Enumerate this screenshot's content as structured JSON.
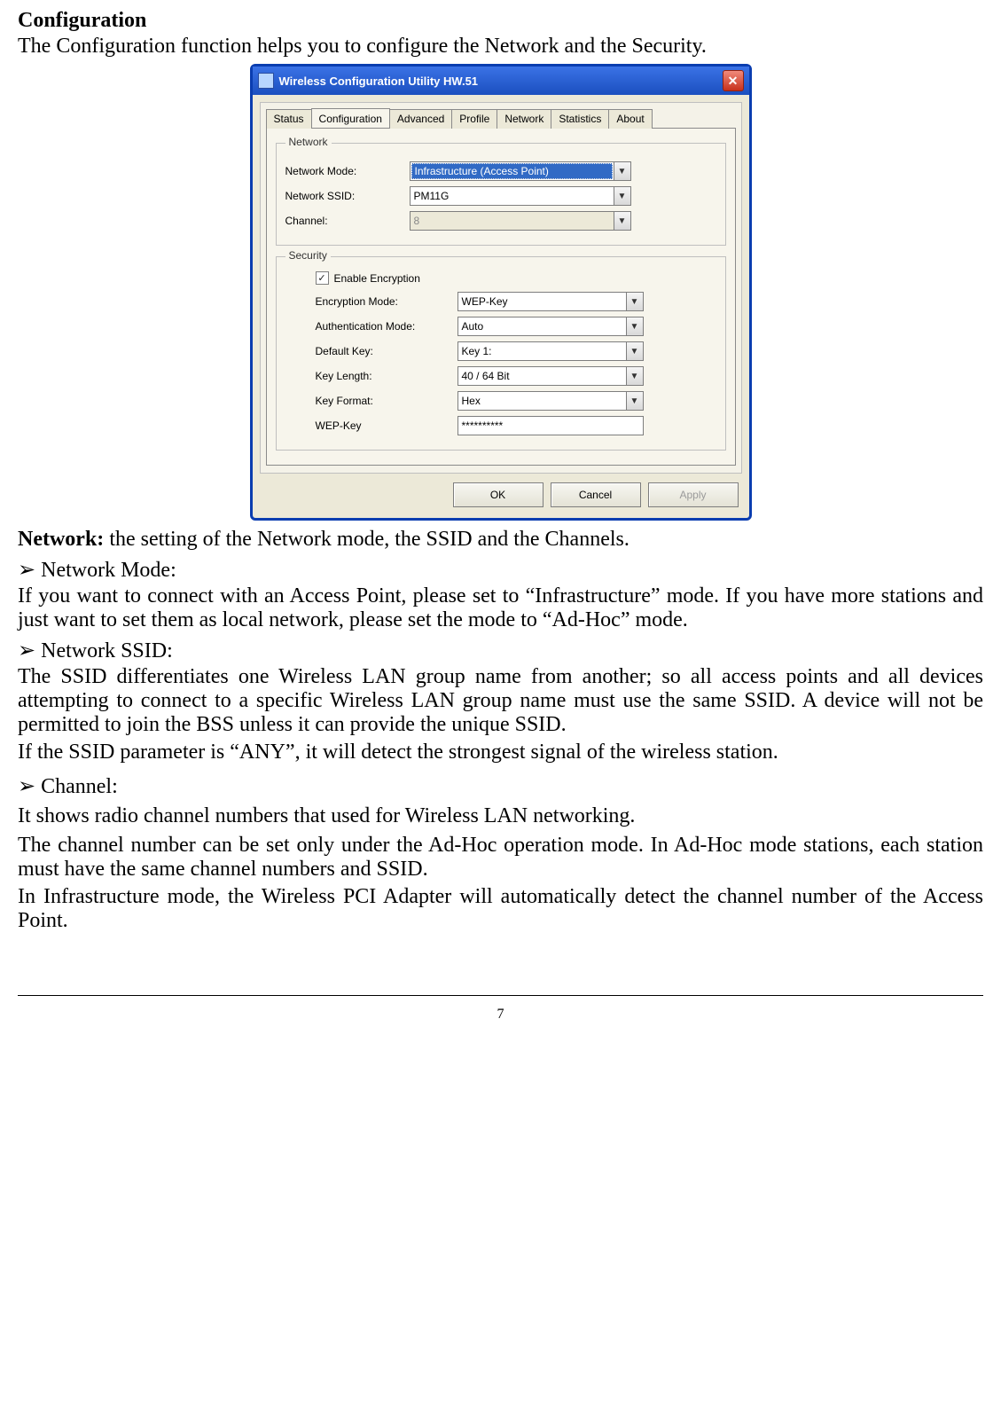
{
  "doc": {
    "title": "Configuration",
    "intro": "The Configuration function helps you to configure the Network and the Security.",
    "network_heading_bold": "Network:",
    "network_heading_rest": " the setting of the Network mode, the SSID and the Channels.",
    "bullets": {
      "mode": "Network Mode:",
      "ssid": "Network SSID:",
      "channel": "Channel:"
    },
    "mode_text": "If you want to connect with an Access Point, please set to “Infrastructure” mode. If you have more stations and just want to set them as local network, please set the mode to “Ad-Hoc” mode.",
    "ssid_text1": "The SSID differentiates one Wireless LAN group name from another; so all access points and all devices attempting to connect to a specific Wireless LAN group name must use the same SSID. A device will not be permitted to join the BSS unless it can provide the unique SSID.",
    "ssid_text2": "If the SSID parameter is “ANY”, it will detect the strongest signal of the wireless station.",
    "channel_text1": "It shows radio channel numbers that used for Wireless LAN networking.",
    "channel_text2": "The channel number can be set only under the Ad-Hoc operation mode. In Ad-Hoc mode stations, each station must have the same channel numbers and SSID.",
    "channel_text3": "In Infrastructure mode, the Wireless PCI Adapter will automatically detect the channel number of the Access Point.",
    "page_number": "7"
  },
  "win": {
    "title": "Wireless Configuration Utility HW.51",
    "tabs": [
      "Status",
      "Configuration",
      "Advanced",
      "Profile",
      "Network",
      "Statistics",
      "About"
    ],
    "active_tab": 1,
    "groups": {
      "network": {
        "title": "Network",
        "mode_label": "Network Mode:",
        "mode_value": "Infrastructure (Access Point)",
        "ssid_label": "Network SSID:",
        "ssid_value": "PM11G",
        "channel_label": "Channel:",
        "channel_value": "8"
      },
      "security": {
        "title": "Security",
        "enable_label": "Enable Encryption",
        "enc_mode_label": "Encryption Mode:",
        "enc_mode_value": "WEP-Key",
        "auth_label": "Authentication Mode:",
        "auth_value": "Auto",
        "defkey_label": "Default Key:",
        "defkey_value": "Key 1:",
        "keylen_label": "Key Length:",
        "keylen_value": "40 / 64 Bit",
        "keyfmt_label": "Key Format:",
        "keyfmt_value": "Hex",
        "wepkey_label": "WEP-Key",
        "wepkey_value": "**********"
      }
    },
    "buttons": {
      "ok": "OK",
      "cancel": "Cancel",
      "apply": "Apply"
    }
  }
}
